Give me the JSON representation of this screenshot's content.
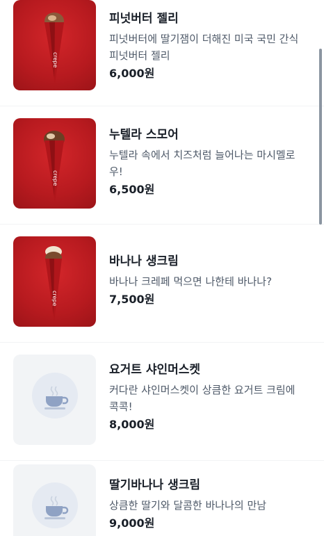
{
  "menu_items": [
    {
      "name": "피넛버터 젤리",
      "desc_lines": [
        "피넛버터에 딸기잼이 더해진 미국 국민 간식",
        "피넛버터 젤리"
      ],
      "price": "6,000원",
      "image": "crepe-photo"
    },
    {
      "name": "누텔라 스모어",
      "desc_lines": [
        "누텔라 속에서 치즈처럼 늘어나는 마시멜로",
        "우!"
      ],
      "price": "6,500원",
      "image": "crepe-photo"
    },
    {
      "name": "바나나 생크림",
      "desc_lines": [
        "바나나 크레페 먹으면 나한테 바나나?"
      ],
      "price": "7,500원",
      "image": "crepe-photo"
    },
    {
      "name": "요거트 샤인머스켓",
      "desc_lines": [
        "커다란 샤인머스켓이 상큼한 요거트 크림에",
        "콕콕!"
      ],
      "price": "8,000원",
      "image": "coffee-cup-icon"
    },
    {
      "name": "딸기바나나 생크림",
      "desc_lines": [
        "상큼한 딸기와 달콤한 바나나의 만남"
      ],
      "price": "9,000원",
      "image": "coffee-cup-icon"
    }
  ],
  "colors": {
    "photo_red": "#c41e23",
    "placeholder_bg": "#f2f4f6",
    "icon_blue": "#8fa2c4"
  }
}
